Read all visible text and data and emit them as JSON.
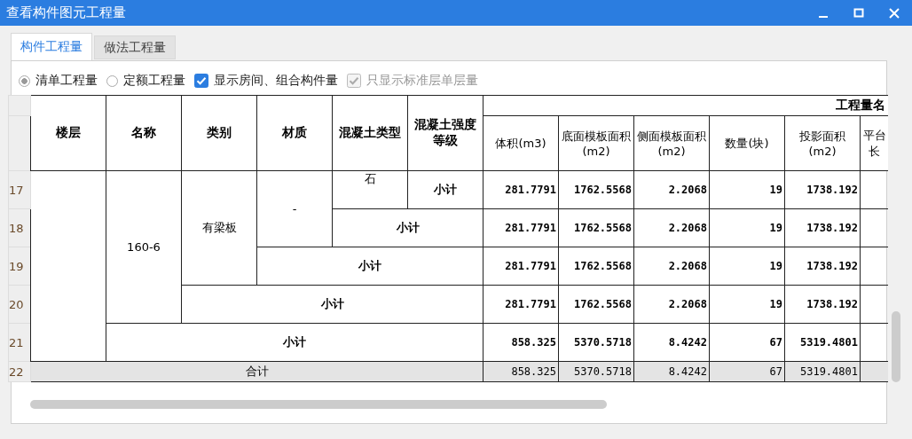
{
  "window": {
    "title": "查看构件图元工程量"
  },
  "tabs": [
    {
      "label": "构件工程量",
      "selected": true
    },
    {
      "label": "做法工程量",
      "selected": false
    }
  ],
  "options": [
    {
      "kind": "radio",
      "label": "清单工程量",
      "selected": true
    },
    {
      "kind": "radio",
      "label": "定额工程量",
      "selected": false
    },
    {
      "kind": "checkbox",
      "label": "显示房间、组合构件量",
      "checked": true,
      "disabled": false
    },
    {
      "kind": "checkbox",
      "label": "只显示标准层单层量",
      "checked": true,
      "disabled": true
    }
  ],
  "table": {
    "group_header": "工程量名",
    "columns": [
      "楼层",
      "名称",
      "类别",
      "材质",
      "混凝土类型",
      "混凝土强度等级"
    ],
    "metric_columns": [
      "体积(m3)",
      "底面模板面积(m2)",
      "侧面模板面积(m2)",
      "数量(块)",
      "投影面积(m2)",
      "平台长"
    ],
    "groups": {
      "name": "160-6",
      "category": "有梁板",
      "material": "-",
      "concrete_type": "石"
    },
    "rows": [
      {
        "row_number": "17",
        "kind": "subtotal",
        "label": "小计",
        "values": [
          "281.7791",
          "1762.5568",
          "2.2068",
          "19",
          "1738.192"
        ]
      },
      {
        "row_number": "18",
        "kind": "subtotal",
        "label": "小计",
        "values": [
          "281.7791",
          "1762.5568",
          "2.2068",
          "19",
          "1738.192"
        ]
      },
      {
        "row_number": "19",
        "kind": "subtotal",
        "label": "小计",
        "values": [
          "281.7791",
          "1762.5568",
          "2.2068",
          "19",
          "1738.192"
        ]
      },
      {
        "row_number": "20",
        "kind": "subtotal",
        "label": "小计",
        "values": [
          "281.7791",
          "1762.5568",
          "2.2068",
          "19",
          "1738.192"
        ]
      },
      {
        "row_number": "21",
        "kind": "subtotal",
        "label": "小计",
        "values": [
          "858.325",
          "5370.5718",
          "8.4242",
          "67",
          "5319.4801"
        ]
      },
      {
        "row_number": "22",
        "kind": "total",
        "label": "合计",
        "values": [
          "858.325",
          "5370.5718",
          "8.4242",
          "67",
          "5319.4801"
        ]
      }
    ]
  }
}
